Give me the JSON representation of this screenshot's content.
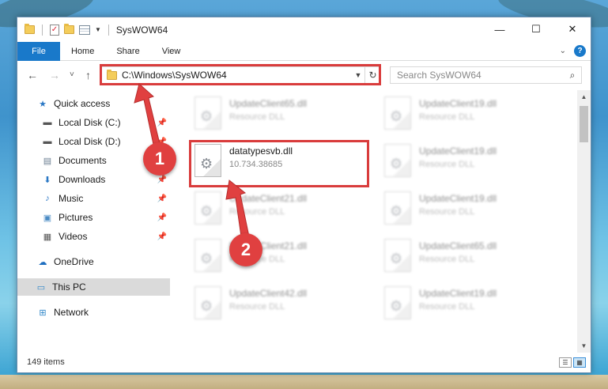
{
  "window": {
    "title": "SysWOW64",
    "controls": {
      "minimize": "—",
      "maximize": "☐",
      "close": "✕"
    }
  },
  "ribbon": {
    "file_tab": "File",
    "tabs": [
      "Home",
      "Share",
      "View"
    ],
    "help": "?"
  },
  "nav": {
    "back": "←",
    "forward": "→",
    "recent": "˅",
    "up": "↑",
    "address": "C:\\Windows\\SysWOW64",
    "search_placeholder": "Search SysWOW64"
  },
  "sidebar": {
    "quick_access": "Quick access",
    "pinned": [
      {
        "label": "Local Disk (C:)",
        "icon": "drive-icon"
      },
      {
        "label": "Local Disk (D:)",
        "icon": "drive-icon"
      },
      {
        "label": "Documents",
        "icon": "documents-icon"
      },
      {
        "label": "Downloads",
        "icon": "downloads-icon"
      },
      {
        "label": "Music",
        "icon": "music-icon"
      },
      {
        "label": "Pictures",
        "icon": "pictures-icon"
      },
      {
        "label": "Videos",
        "icon": "videos-icon"
      }
    ],
    "onedrive": "OneDrive",
    "this_pc": "This PC",
    "network": "Network"
  },
  "files": [
    {
      "name": "UpdateClient65.dll",
      "type": "Resource DLL"
    },
    {
      "name": "UpdateClient19.dll",
      "type": "Resource DLL"
    },
    {
      "name": "datatypesvb.dll",
      "type": "10.734.38685"
    },
    {
      "name": "UpdateClient19.dll",
      "type": "Resource DLL"
    },
    {
      "name": "UpdateClient21.dll",
      "type": "Resource DLL"
    },
    {
      "name": "UpdateClient19.dll",
      "type": "Resource DLL"
    },
    {
      "name": "UpdateClient21.dll",
      "type": "Resource DLL"
    },
    {
      "name": "UpdateClient65.dll",
      "type": "Resource DLL"
    },
    {
      "name": "UpdateClient42.dll",
      "type": "Resource DLL"
    },
    {
      "name": "UpdateClient19.dll",
      "type": "Resource DLL"
    }
  ],
  "status": {
    "item_count": "149 items"
  },
  "annotations": {
    "step1": "1",
    "step2": "2",
    "accent": "#d93c3c"
  }
}
